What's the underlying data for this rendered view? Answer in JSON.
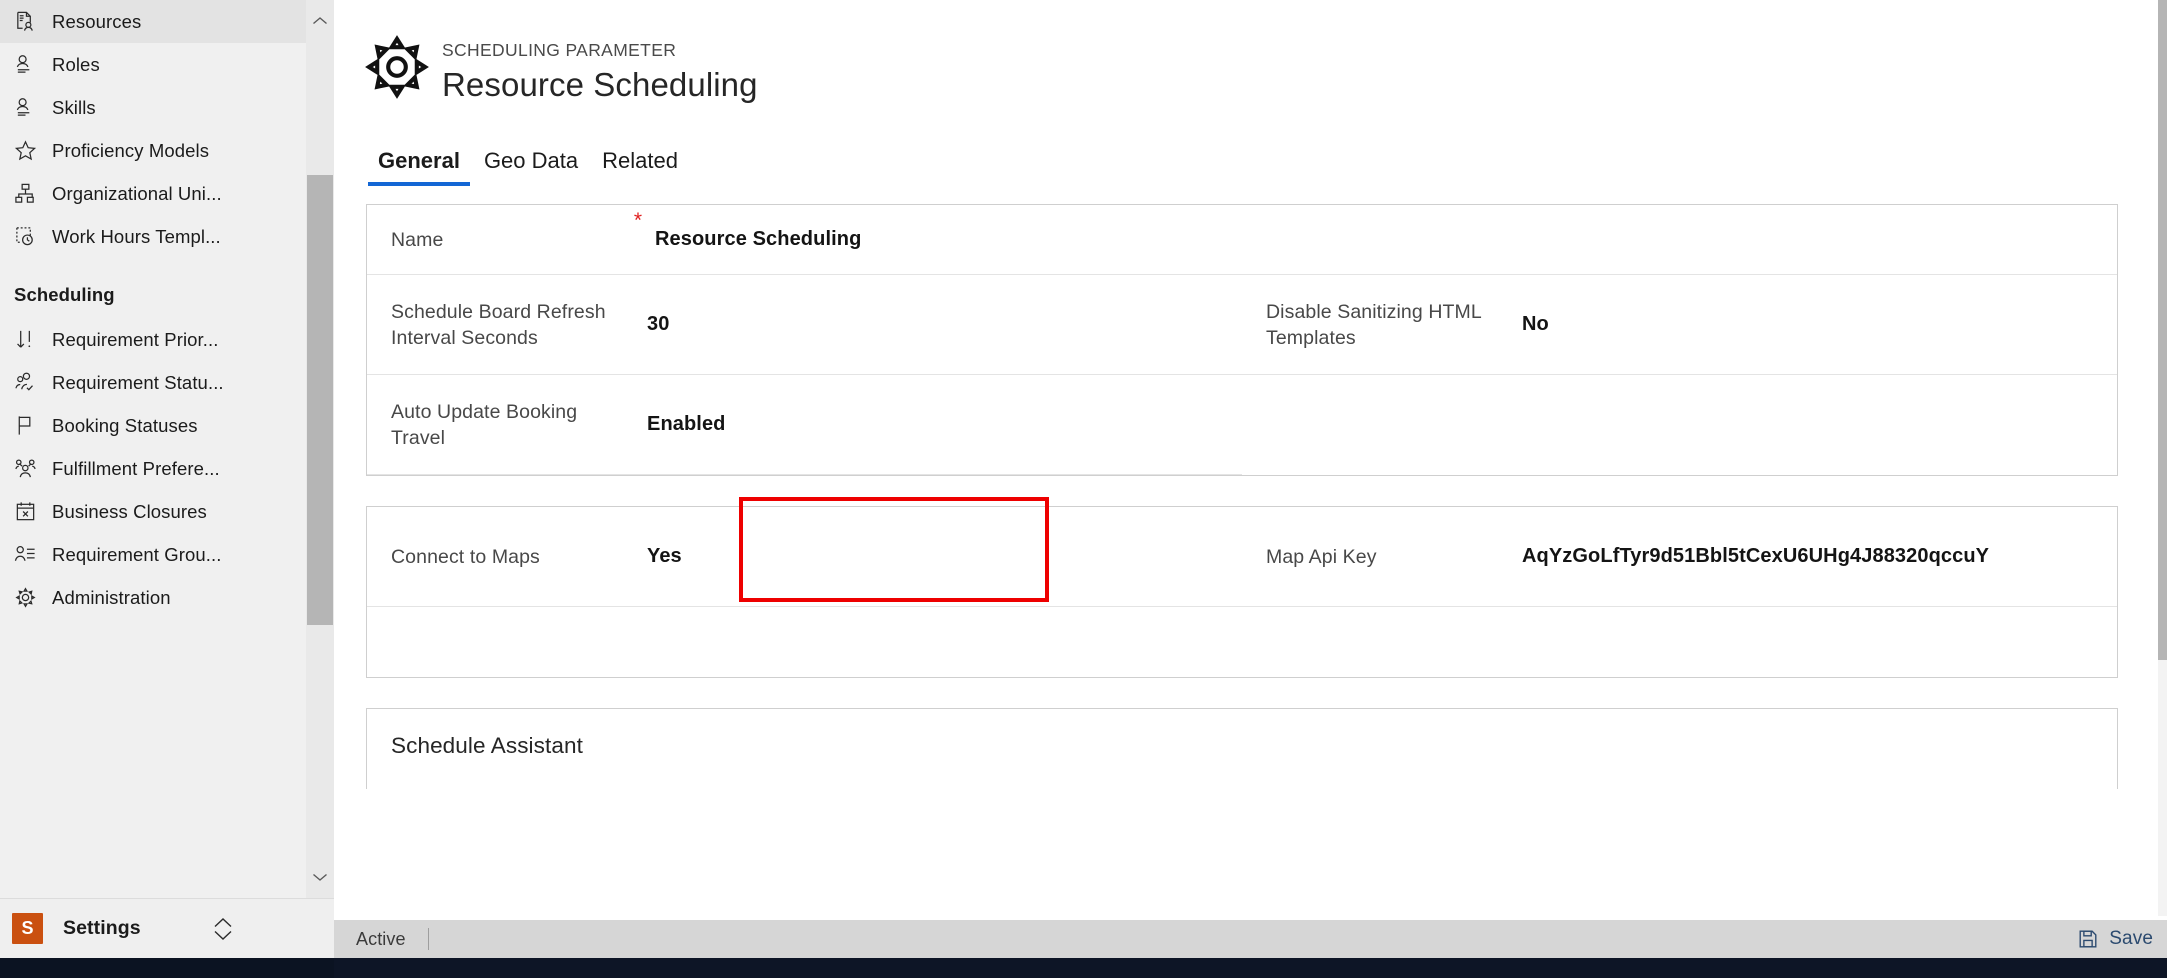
{
  "sidebar": {
    "top_items": [
      {
        "label": "Resources",
        "icon": "resource-document-person-icon"
      },
      {
        "label": "Roles",
        "icon": "person-card-icon"
      },
      {
        "label": "Skills",
        "icon": "person-card-icon"
      },
      {
        "label": "Proficiency Models",
        "icon": "star-icon"
      },
      {
        "label": "Organizational Uni...",
        "icon": "org-hierarchy-icon"
      },
      {
        "label": "Work Hours Templ...",
        "icon": "dotted-clock-icon"
      }
    ],
    "group_title": "Scheduling",
    "group_items": [
      {
        "label": "Requirement Prior...",
        "icon": "sort-priority-icon"
      },
      {
        "label": "Requirement Statu...",
        "icon": "person-check-icon"
      },
      {
        "label": "Booking Statuses",
        "icon": "flag-icon"
      },
      {
        "label": "Fulfillment Prefere...",
        "icon": "people-group-icon"
      },
      {
        "label": "Business Closures",
        "icon": "calendar-x-icon"
      },
      {
        "label": "Requirement Grou...",
        "icon": "person-list-icon"
      },
      {
        "label": "Administration",
        "icon": "gear-icon"
      }
    ],
    "scroll_up_icon": "chevron-up-icon",
    "scroll_down_icon": "chevron-down-icon",
    "area_switcher": {
      "badge": "S",
      "name": "Settings",
      "icon": "chevron-up-down-icon"
    }
  },
  "header": {
    "icon": "gear-icon",
    "eyebrow": "SCHEDULING PARAMETER",
    "title": "Resource Scheduling"
  },
  "tabs": [
    {
      "label": "General",
      "active": true
    },
    {
      "label": "Geo Data",
      "active": false
    },
    {
      "label": "Related",
      "active": false
    }
  ],
  "form": {
    "card1": {
      "name": {
        "label": "Name",
        "required_marker": "*",
        "value": "Resource Scheduling"
      },
      "refresh_interval": {
        "label": "Schedule Board Refresh Interval Seconds",
        "value": "30"
      },
      "auto_update_booking_travel": {
        "label": "Auto Update Booking Travel",
        "value": "Enabled"
      },
      "disable_sanitizing": {
        "label": "Disable Sanitizing HTML Templates",
        "value": "No"
      }
    },
    "card2": {
      "connect_to_maps": {
        "label": "Connect to Maps",
        "value": "Yes"
      },
      "map_api_key": {
        "label": "Map Api Key",
        "value": "AqYzGoLfTyr9d51Bbl5tCexU6UHg4J88320qccuY"
      }
    },
    "card3": {
      "section_title": "Schedule Assistant"
    }
  },
  "statusbar": {
    "record_status": "Active",
    "save_label": "Save",
    "save_icon": "floppy-save-icon"
  },
  "colors": {
    "accent_blue": "#1367d5",
    "annotation_red": "#ee0000",
    "required_red": "#e01f1f",
    "area_badge_orange": "#ca5010",
    "save_blue": "#2b4a6f",
    "sidebar_bg": "#f0f0f0",
    "statusbar_bg": "#d6d6d6"
  },
  "annotation": {
    "highlights": "auto-update-booking-travel-field"
  }
}
